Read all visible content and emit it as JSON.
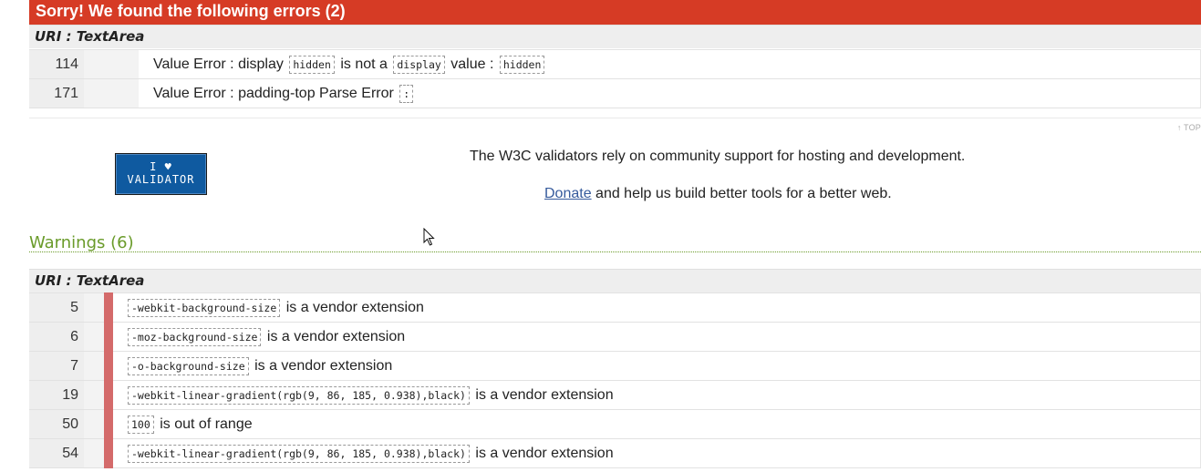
{
  "errors": {
    "heading": "Sorry! We found the following errors (2)",
    "uri_label": "URI : ",
    "uri_value": "TextArea",
    "rows": [
      {
        "line": "114",
        "parts": [
          {
            "t": "text",
            "v": "Value Error : display "
          },
          {
            "t": "code",
            "v": "hidden"
          },
          {
            "t": "text",
            "v": " is not a "
          },
          {
            "t": "code",
            "v": "display"
          },
          {
            "t": "text",
            "v": " value : "
          },
          {
            "t": "code",
            "v": "hidden"
          }
        ]
      },
      {
        "line": "171",
        "parts": [
          {
            "t": "text",
            "v": "Value Error : padding-top Parse Error "
          },
          {
            "t": "code",
            "v": ":"
          }
        ]
      }
    ]
  },
  "top_link": "↑ TOP",
  "badge": {
    "line1": "I ♥",
    "line2": "VALIDATOR"
  },
  "support": {
    "text": "The W3C validators rely on community support for hosting and development.",
    "donate_link": "Donate",
    "donate_rest": " and help us build better tools for a better web."
  },
  "warnings": {
    "heading": "Warnings (6)",
    "uri_label": "URI : ",
    "uri_value": "TextArea",
    "rows": [
      {
        "line": "5",
        "code": "-webkit-background-size",
        "msg": " is a vendor extension"
      },
      {
        "line": "6",
        "code": "-moz-background-size",
        "msg": " is a vendor extension"
      },
      {
        "line": "7",
        "code": "-o-background-size",
        "msg": " is a vendor extension"
      },
      {
        "line": "19",
        "code": "-webkit-linear-gradient(rgb(9, 86, 185, 0.938),black)",
        "msg": " is a vendor extension"
      },
      {
        "line": "50",
        "code": "100",
        "msg": " is out of range"
      },
      {
        "line": "54",
        "code": "-webkit-linear-gradient(rgb(9, 86, 185, 0.938),black)",
        "msg": " is a vendor extension"
      }
    ]
  },
  "colors": {
    "error_header": "#d63b25",
    "warning_heading": "#6a9b2a",
    "warning_bar": "#d46a6a",
    "badge_bg": "#0f5aa0",
    "link": "#355a9c"
  }
}
